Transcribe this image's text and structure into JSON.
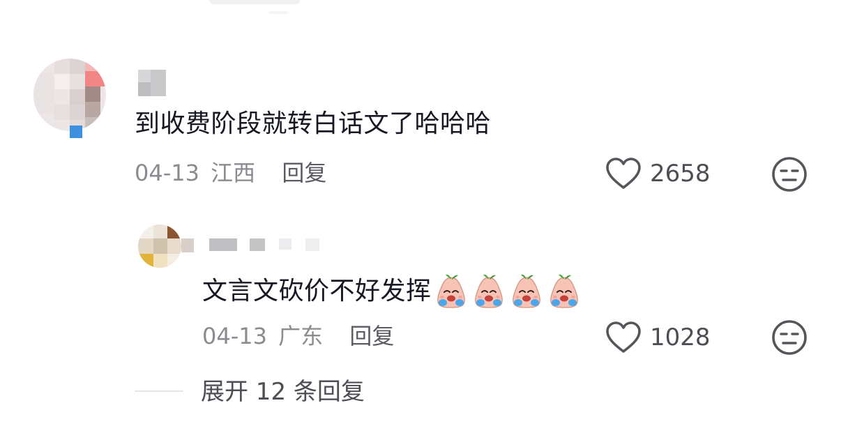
{
  "comment": {
    "text": "到收费阶段就转白话文了哈哈哈",
    "date": "04-13",
    "location": "江西",
    "reply_label": "回复",
    "like_count": "2658"
  },
  "reply": {
    "text": "文言文砍价不好发挥",
    "emoji": [
      "crying-peach-emoji",
      "crying-peach-emoji",
      "crying-peach-emoji",
      "crying-peach-emoji"
    ],
    "date": "04-13",
    "location": "广东",
    "reply_label": "回复",
    "like_count": "1028"
  },
  "expand": {
    "label": "展开 12 条回复"
  },
  "colors": {
    "primary_text": "#161823",
    "secondary_text": "#8a8b91",
    "icon": "#55565c"
  }
}
